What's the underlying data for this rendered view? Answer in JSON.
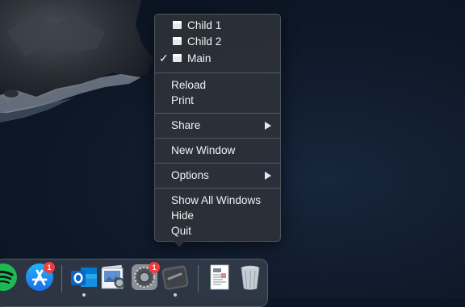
{
  "context_menu": {
    "windows": [
      {
        "label": "Child 1",
        "checked": false
      },
      {
        "label": "Child 2",
        "checked": false
      },
      {
        "label": "Main",
        "checked": true
      }
    ],
    "check_glyph": "✓",
    "reload_label": "Reload",
    "print_label": "Print",
    "share_label": "Share",
    "new_window_label": "New Window",
    "options_label": "Options",
    "show_all_windows_label": "Show All Windows",
    "hide_label": "Hide",
    "quit_label": "Quit"
  },
  "dock": {
    "items": [
      {
        "name": "Spotify",
        "icon": "spotify-icon",
        "running": false
      },
      {
        "name": "App Store",
        "icon": "app-store-icon",
        "badge": "1",
        "running": false
      },
      {
        "name": "Microsoft Outlook",
        "icon": "outlook-icon",
        "running": true
      },
      {
        "name": "Preview",
        "icon": "preview-icon",
        "running": false
      },
      {
        "name": "System Preferences",
        "icon": "system-preferences-icon",
        "badge": "1",
        "running": false
      },
      {
        "name": "Electron App",
        "icon": "electron-app-icon",
        "running": true
      },
      {
        "name": "Document",
        "icon": "document-icon",
        "running": false
      },
      {
        "name": "Trash",
        "icon": "trash-icon",
        "running": false
      }
    ]
  },
  "colors": {
    "menu_bg": "#2c3139",
    "badge": "#ef3d3d",
    "outlook_blue": "#0a64c8",
    "app_store_blue": "#1f8cf5",
    "spotify_green": "#1db954"
  }
}
